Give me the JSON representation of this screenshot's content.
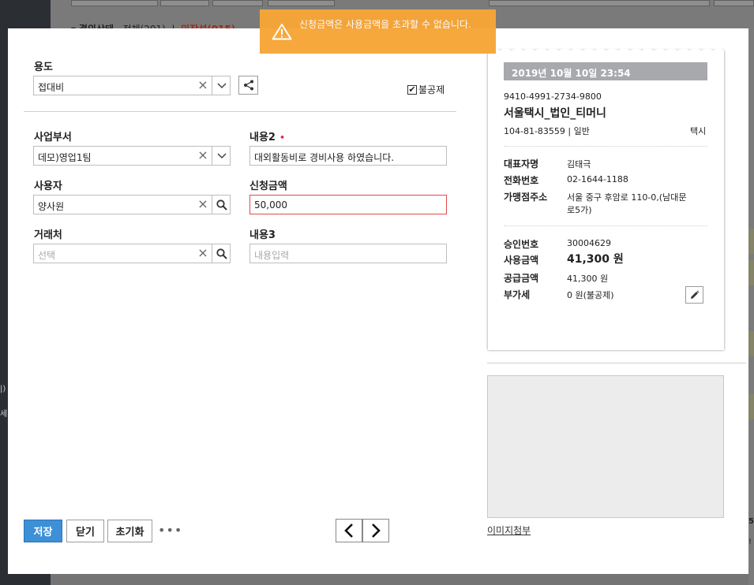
{
  "background": {
    "subheader": {
      "title": "결의상태",
      "all": "전체(201)",
      "sep": "|",
      "draft": "미작성(015)"
    },
    "left_fragments": [
      "|)",
      "세)"
    ],
    "right_fragments": [
      "5",
      "!"
    ]
  },
  "toast": {
    "icon": "warning-icon",
    "message": "신청금액은 사용금액을 초과할 수 없습니다."
  },
  "form": {
    "purpose": {
      "label": "용도",
      "value": "접대비"
    },
    "non_deductible": {
      "label": "불공제",
      "checked": true
    },
    "department": {
      "label": "사업부서",
      "value": "데모)영업1팀"
    },
    "content2": {
      "label": "내용2",
      "required_mark": "•",
      "value": "대외활동비로 경비사용 하였습니다."
    },
    "user": {
      "label": "사용자",
      "value": "양사원"
    },
    "request_amount": {
      "label": "신청금액",
      "value": "50,000"
    },
    "vendor": {
      "label": "거래처",
      "placeholder": "선택"
    },
    "content3": {
      "label": "내용3",
      "placeholder": "내용입력"
    }
  },
  "buttons": {
    "save": "저장",
    "close": "닫기",
    "reset": "초기화",
    "more": "•••"
  },
  "receipt": {
    "datetime": "2019년 10월 10일 23:54",
    "card_number": "9410-4991-2734-9800",
    "merchant_name": "서울택시_법인_티머니",
    "business_number": "104-81-83559 | 일반",
    "category": "택시",
    "rep_label": "대표자명",
    "rep_value": "김태극",
    "phone_label": "전화번호",
    "phone_value": "02-1644-1188",
    "address_label": "가맹점주소",
    "address_line1": "서울 중구 후암로 110-0,(남대문",
    "address_line2": "로5가)",
    "approval_label": "승인번호",
    "approval_value": "30004629",
    "use_amount_label": "사용금액",
    "use_amount_value": "41,300 원",
    "supply_label": "공급금액",
    "supply_value": "41,300 원",
    "vat_label": "부가세",
    "vat_value": "0 원(불공제)"
  },
  "attachment": {
    "label": "이미지첨부"
  },
  "colors": {
    "primary": "#3d8fd6",
    "toast": "#f7a637",
    "error_border": "#e34a4a",
    "required": "#e0304e"
  }
}
